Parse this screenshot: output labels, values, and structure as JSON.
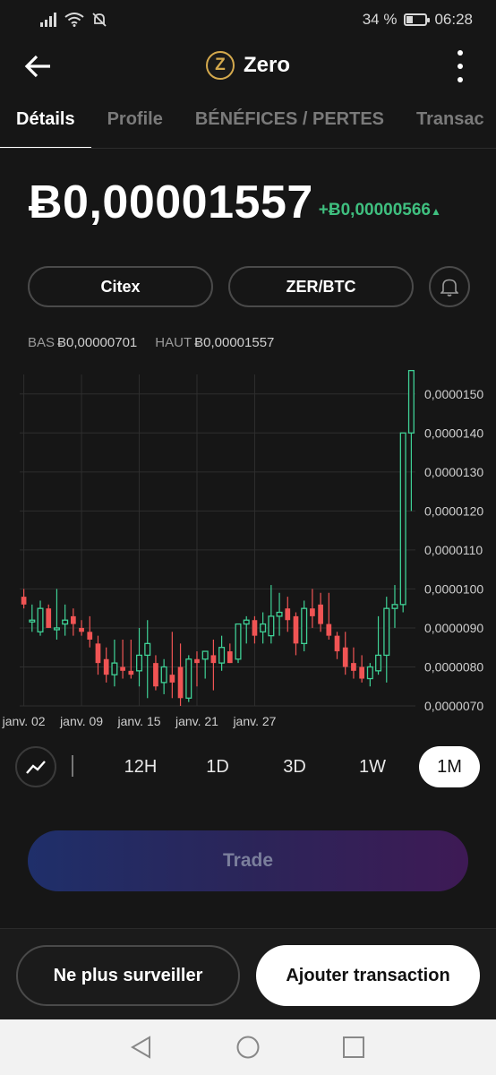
{
  "status_bar": {
    "battery": "34 %",
    "battery_level": 0.34,
    "time": "06:28"
  },
  "header": {
    "coin_symbol_letter": "Z",
    "coin_name": "Zero"
  },
  "tabs": [
    {
      "label": "Détails",
      "active": true
    },
    {
      "label": "Profile",
      "active": false
    },
    {
      "label": "BÉNÉFICES / PERTES",
      "active": false
    },
    {
      "label": "Transac",
      "active": false
    }
  ],
  "price": {
    "value": "Ƀ0,00001557",
    "change": "+Ƀ0,00000566",
    "change_arrow": "▲"
  },
  "pills": {
    "exchange": "Citex",
    "pair": "ZER/BTC"
  },
  "range": {
    "low_label": "BAS",
    "low_value": "Ƀ0,00000701",
    "high_label": "HAUT",
    "high_value": "Ƀ0,00001557"
  },
  "colors": {
    "up": "#3fd196",
    "down": "#f05454",
    "accent_green": "#3fbf7f"
  },
  "chart_data": {
    "type": "candlestick",
    "y_axis_ticks": [
      "0,0000150",
      "0,0000140",
      "0,0000130",
      "0,0000120",
      "0,0000110",
      "0,0000100",
      "0,0000090",
      "0,0000080",
      "0,0000070"
    ],
    "ylim": [
      7e-06,
      1.55e-05
    ],
    "x_tick_labels": [
      "janv. 02",
      "janv. 09",
      "janv. 15",
      "janv. 21",
      "janv. 27"
    ],
    "x_tick_index": [
      0,
      7,
      14,
      21,
      28
    ],
    "grid": true,
    "candles": [
      {
        "o": 9.8,
        "h": 10.0,
        "l": 9.5,
        "c": 9.6
      },
      {
        "o": 9.2,
        "h": 9.6,
        "l": 8.9,
        "c": 9.2
      },
      {
        "o": 8.9,
        "h": 9.7,
        "l": 8.8,
        "c": 9.5
      },
      {
        "o": 9.5,
        "h": 9.6,
        "l": 9.0,
        "c": 9.0
      },
      {
        "o": 9.0,
        "h": 10.0,
        "l": 8.7,
        "c": 9.0
      },
      {
        "o": 9.1,
        "h": 9.6,
        "l": 8.8,
        "c": 9.2
      },
      {
        "o": 9.3,
        "h": 9.5,
        "l": 8.8,
        "c": 9.1
      },
      {
        "o": 9.0,
        "h": 9.2,
        "l": 8.8,
        "c": 8.9
      },
      {
        "o": 8.9,
        "h": 9.3,
        "l": 8.5,
        "c": 8.7
      },
      {
        "o": 8.6,
        "h": 8.8,
        "l": 7.8,
        "c": 8.1
      },
      {
        "o": 8.2,
        "h": 8.5,
        "l": 7.6,
        "c": 7.8
      },
      {
        "o": 7.8,
        "h": 8.7,
        "l": 7.5,
        "c": 8.1
      },
      {
        "o": 8.0,
        "h": 8.7,
        "l": 7.7,
        "c": 7.9
      },
      {
        "o": 7.9,
        "h": 8.7,
        "l": 7.7,
        "c": 7.8
      },
      {
        "o": 7.9,
        "h": 9.0,
        "l": 7.5,
        "c": 8.3
      },
      {
        "o": 8.3,
        "h": 9.2,
        "l": 7.2,
        "c": 8.6
      },
      {
        "o": 8.1,
        "h": 8.3,
        "l": 7.4,
        "c": 7.5
      },
      {
        "o": 7.6,
        "h": 8.2,
        "l": 7.3,
        "c": 8.0
      },
      {
        "o": 7.8,
        "h": 8.9,
        "l": 7.2,
        "c": 7.6
      },
      {
        "o": 8.0,
        "h": 8.6,
        "l": 7.0,
        "c": 7.2
      },
      {
        "o": 7.2,
        "h": 8.3,
        "l": 7.1,
        "c": 8.2
      },
      {
        "o": 8.2,
        "h": 8.4,
        "l": 7.5,
        "c": 8.1
      },
      {
        "o": 8.2,
        "h": 8.4,
        "l": 7.7,
        "c": 8.4
      },
      {
        "o": 8.3,
        "h": 8.7,
        "l": 7.4,
        "c": 8.1
      },
      {
        "o": 8.1,
        "h": 8.8,
        "l": 7.9,
        "c": 8.5
      },
      {
        "o": 8.4,
        "h": 8.6,
        "l": 8.1,
        "c": 8.1
      },
      {
        "o": 8.2,
        "h": 9.1,
        "l": 8.1,
        "c": 9.1
      },
      {
        "o": 9.1,
        "h": 9.3,
        "l": 8.6,
        "c": 9.2
      },
      {
        "o": 9.2,
        "h": 9.3,
        "l": 8.6,
        "c": 8.8
      },
      {
        "o": 8.9,
        "h": 9.4,
        "l": 8.6,
        "c": 9.1
      },
      {
        "o": 8.8,
        "h": 10.1,
        "l": 8.6,
        "c": 9.3
      },
      {
        "o": 9.3,
        "h": 9.9,
        "l": 8.8,
        "c": 9.4
      },
      {
        "o": 9.5,
        "h": 9.8,
        "l": 8.9,
        "c": 9.2
      },
      {
        "o": 9.3,
        "h": 9.4,
        "l": 8.3,
        "c": 8.6
      },
      {
        "o": 8.6,
        "h": 9.7,
        "l": 8.4,
        "c": 9.5
      },
      {
        "o": 9.5,
        "h": 10.0,
        "l": 9.0,
        "c": 9.3
      },
      {
        "o": 9.6,
        "h": 9.9,
        "l": 8.9,
        "c": 9.1
      },
      {
        "o": 9.1,
        "h": 9.9,
        "l": 8.7,
        "c": 8.8
      },
      {
        "o": 8.8,
        "h": 8.9,
        "l": 8.2,
        "c": 8.4
      },
      {
        "o": 8.5,
        "h": 8.9,
        "l": 7.8,
        "c": 8.0
      },
      {
        "o": 8.1,
        "h": 8.5,
        "l": 7.7,
        "c": 7.9
      },
      {
        "o": 8.0,
        "h": 8.3,
        "l": 7.6,
        "c": 7.7
      },
      {
        "o": 7.7,
        "h": 8.1,
        "l": 7.5,
        "c": 8.0
      },
      {
        "o": 7.9,
        "h": 9.3,
        "l": 7.8,
        "c": 8.3
      },
      {
        "o": 8.3,
        "h": 9.8,
        "l": 7.6,
        "c": 9.5
      },
      {
        "o": 9.5,
        "h": 10.1,
        "l": 9.0,
        "c": 9.6
      },
      {
        "o": 9.6,
        "h": 14.0,
        "l": 9.4,
        "c": 14.0
      },
      {
        "o": 14.0,
        "h": 15.6,
        "l": 12.0,
        "c": 15.6
      }
    ],
    "price_unit_note": "candle values in 1e-6 BTC"
  },
  "timeframes": {
    "items": [
      "12H",
      "1D",
      "3D",
      "1W",
      "1M"
    ],
    "active": "1M"
  },
  "trade_button": "Trade",
  "bottom_buttons": {
    "unwatch": "Ne plus surveiller",
    "add_transaction": "Ajouter transaction"
  }
}
